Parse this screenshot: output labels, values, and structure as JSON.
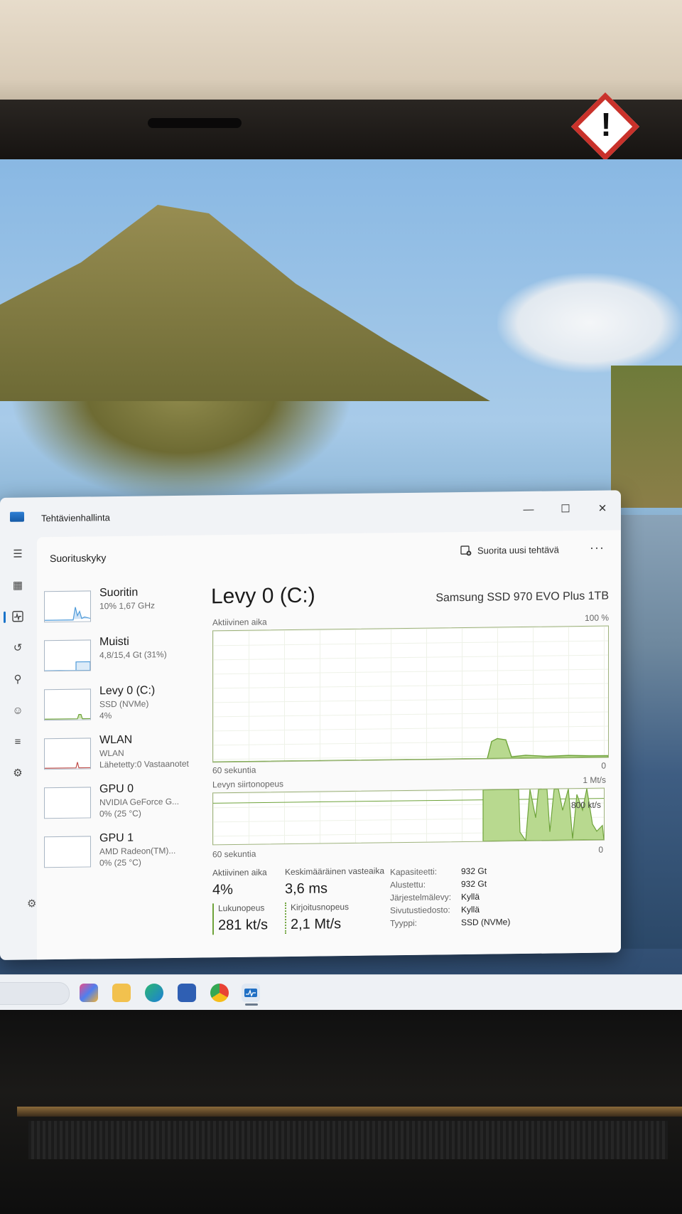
{
  "app": {
    "title": "Tehtävienhallinta"
  },
  "window_controls": {
    "minimize": "—",
    "maximize": "☐",
    "close": "✕"
  },
  "header": {
    "title": "Suorituskyky",
    "run_task_label": "Suorita uusi tehtävä",
    "more_label": "···"
  },
  "nav_icons": [
    "menu-icon",
    "processes-icon",
    "performance-icon",
    "history-icon",
    "startup-icon",
    "users-icon",
    "details-icon",
    "services-icon"
  ],
  "perf_items": [
    {
      "id": "cpu",
      "title": "Suoritin",
      "line1": "10% 1,67 GHz",
      "line2": ""
    },
    {
      "id": "memory",
      "title": "Muisti",
      "line1": "4,8/15,4 Gt (31%)",
      "line2": ""
    },
    {
      "id": "disk",
      "title": "Levy 0 (C:)",
      "line1": "SSD (NVMe)",
      "line2": "4%"
    },
    {
      "id": "wlan",
      "title": "WLAN",
      "line1": "WLAN",
      "line2": "Lähetetty:0 Vastaanotet"
    },
    {
      "id": "gpu0",
      "title": "GPU 0",
      "line1": "NVIDIA GeForce G...",
      "line2": "0% (25 °C)"
    },
    {
      "id": "gpu1",
      "title": "GPU 1",
      "line1": "AMD Radeon(TM)...",
      "line2": "0% (25 °C)"
    }
  ],
  "detail": {
    "title": "Levy 0 (C:)",
    "model": "Samsung SSD 970 EVO Plus 1TB",
    "active_time_label": "Aktiivinen aika",
    "active_time_max": "100 %",
    "graph1_left": "60 sekuntia",
    "graph1_right": "0",
    "transfer_label": "Levyn siirtonopeus",
    "transfer_max": "1 Mt/s",
    "transfer_mid": "800 kt/s",
    "graph2_left": "60 sekuntia",
    "graph2_right": "0"
  },
  "stats": {
    "active_time": {
      "label": "Aktiivinen aika",
      "value": "4%"
    },
    "response": {
      "label": "Keskimääräinen vasteaika",
      "value": "3,6 ms"
    },
    "read": {
      "label": "Lukunopeus",
      "value": "281 kt/s"
    },
    "write": {
      "label": "Kirjoitusnopeus",
      "value": "2,1 Mt/s"
    }
  },
  "properties": [
    {
      "key": "Kapasiteetti:",
      "value": "932 Gt"
    },
    {
      "key": "Alustettu:",
      "value": "932 Gt"
    },
    {
      "key": "Järjestelmälevy:",
      "value": "Kyllä"
    },
    {
      "key": "Sivutustiedosto:",
      "value": "Kyllä"
    },
    {
      "key": "Tyyppi:",
      "value": "SSD (NVMe)"
    }
  ],
  "colors": {
    "disk_green": "#a8cf7e",
    "disk_line": "#6ea33a",
    "cpu_blue": "#4f9bd9"
  }
}
